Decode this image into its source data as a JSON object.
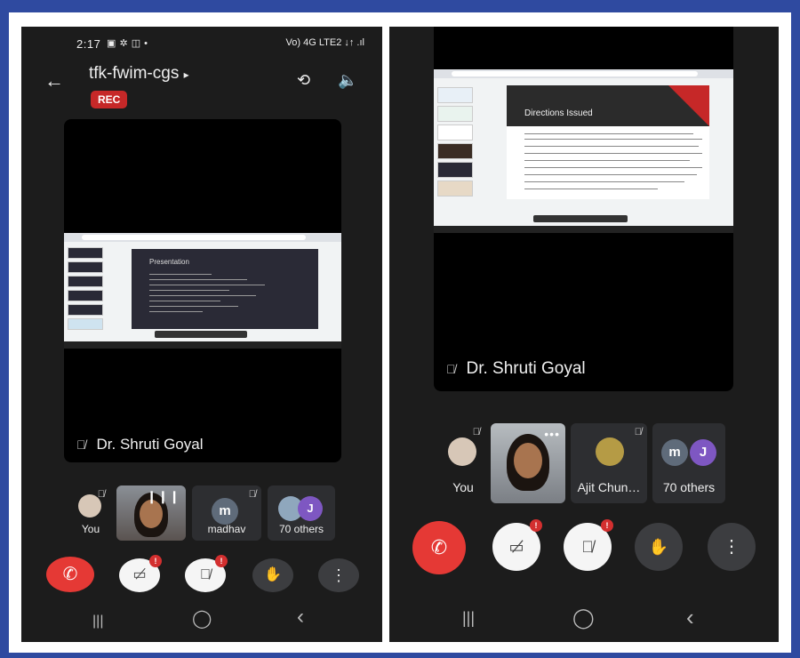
{
  "left_phone": {
    "status_time": "2:17",
    "status_right": "Vo) 4G LTE2 ↓↑ .ıl",
    "meeting_title": "tfk-fwim-cgs",
    "title_caret": "▸",
    "rec_badge": "REC",
    "shared_slide_title": "Presentation",
    "speaker_name": "Dr. Shruti Goyal",
    "tiles": [
      {
        "label": "You"
      },
      {
        "label": ""
      },
      {
        "label": "madhav",
        "avatar_letter": "m"
      },
      {
        "label": "70 others",
        "avatar_letter": "J"
      }
    ],
    "badges": {
      "video": "!",
      "mic": "!"
    }
  },
  "right_phone": {
    "shared_slide_title": "Directions Issued",
    "speaker_name": "Dr. Shruti Goyal",
    "tiles": [
      {
        "label": "You"
      },
      {
        "label": ""
      },
      {
        "label": "Ajit Chun…"
      },
      {
        "label": "70 others",
        "avatar_letters": [
          "m",
          "J"
        ]
      }
    ],
    "badges": {
      "video": "!",
      "mic": "!"
    }
  },
  "icons": {
    "back": "←",
    "camera_switch": "⟲",
    "speaker": "🔈",
    "mic_off": "🎙̸",
    "end_call": "✆",
    "video_off": "▭̸",
    "hand": "✋",
    "more": "⋮",
    "nav_recents": "|||",
    "nav_home": "◯",
    "nav_back": "‹"
  },
  "colors": {
    "frame_blue": "#2f4aa0",
    "phone_bg": "#1c1c1c",
    "end_call_red": "#e53935",
    "rec_red": "#c62828",
    "avatar_grey": "#5f6b7a",
    "avatar_purple": "#7e57c2"
  }
}
